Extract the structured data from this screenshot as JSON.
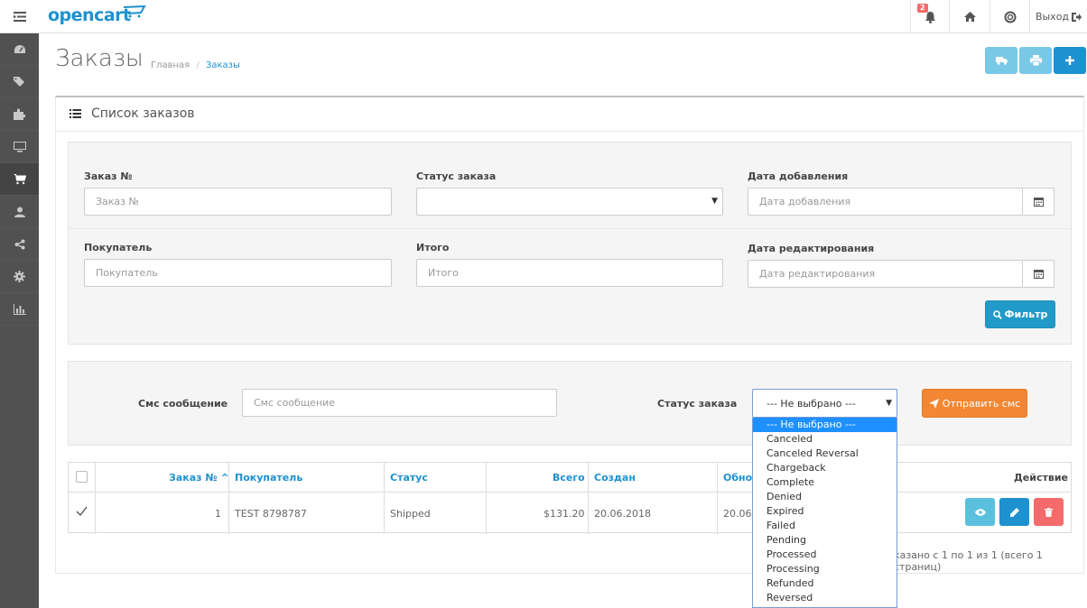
{
  "header": {
    "logo": "opencart",
    "notifications_count": "2",
    "logout_label": "Выход"
  },
  "sidebar": {
    "items": [
      {
        "icon": "dashboard-icon"
      },
      {
        "icon": "tags-icon"
      },
      {
        "icon": "puzzle-icon"
      },
      {
        "icon": "monitor-icon"
      },
      {
        "icon": "cart-icon",
        "active": true
      },
      {
        "icon": "user-icon"
      },
      {
        "icon": "share-icon"
      },
      {
        "icon": "gear-icon"
      },
      {
        "icon": "bar-chart-icon"
      }
    ]
  },
  "page": {
    "title": "Заказы",
    "breadcrumb": [
      "Главная",
      "Заказы"
    ]
  },
  "panel": {
    "title": "Список заказов"
  },
  "filter": {
    "order_id_label": "Заказ №",
    "order_id_placeholder": "Заказ №",
    "status_label": "Статус заказа",
    "status_value": "",
    "date_added_label": "Дата добавления",
    "date_added_placeholder": "Дата добавления",
    "customer_label": "Покупатель",
    "customer_placeholder": "Покупатель",
    "total_label": "Итого",
    "total_placeholder": "Итого",
    "date_modified_label": "Дата редактирования",
    "date_modified_placeholder": "Дата редактирования",
    "filter_button": "Фильтр"
  },
  "sms": {
    "message_label": "Смс сообщение",
    "message_placeholder": "Смс сообщение",
    "status_label": "Статус заказа",
    "status_value": "--- Не выбрано ---",
    "send_button": "Отправить смс",
    "status_options": [
      "--- Не выбрано ---",
      "Canceled",
      "Canceled Reversal",
      "Chargeback",
      "Complete",
      "Denied",
      "Expired",
      "Failed",
      "Pending",
      "Processed",
      "Processing",
      "Refunded",
      "Reversed"
    ]
  },
  "table": {
    "columns": {
      "order_id": "Заказ №",
      "customer": "Покупатель",
      "status": "Статус",
      "total": "Всего",
      "date_added": "Создан",
      "date_modified": "Обнов",
      "action": "Действие"
    },
    "rows": [
      {
        "order_id": "1",
        "customer": "TEST 8798787",
        "status": "Shipped",
        "total": "$131.20",
        "date_added": "20.06.2018",
        "date_modified": "20.06.2"
      }
    ]
  },
  "pagination": {
    "text": "казано с 1 по 1 из 1 (всего 1 страниц)"
  },
  "colors": {
    "primary": "#1e91cf",
    "info": "#5bc0de",
    "danger": "#f56b6b",
    "warning": "#f38733",
    "sidebar": "#515151"
  }
}
